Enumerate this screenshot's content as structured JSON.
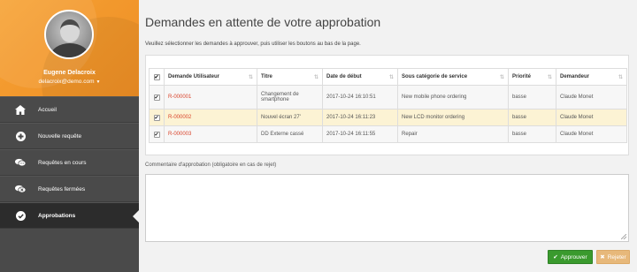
{
  "user": {
    "name": "Eugene Delacroix",
    "email": "delacroix@demo.com"
  },
  "nav": {
    "items": [
      {
        "label": "Accueil",
        "icon": "home-icon"
      },
      {
        "label": "Nouvelle requête",
        "icon": "plus-circle-icon"
      },
      {
        "label": "Requêtes en cours",
        "icon": "chat-bubbles-icon"
      },
      {
        "label": "Requêtes fermées",
        "icon": "chat-bubbles-closed-icon"
      },
      {
        "label": "Approbations",
        "icon": "check-circle-icon",
        "active": true
      }
    ]
  },
  "main": {
    "title": "Demandes en attente de votre approbation",
    "instructions": "Veuillez sélectionner les demandes à approuver, puis utiliser les boutons au bas de la page."
  },
  "table": {
    "columns": [
      "Demande Utilisateur",
      "Titre",
      "Date de début",
      "Sous catégorie de service",
      "Priorité",
      "Demandeur"
    ],
    "rows": [
      {
        "id": "R-000001",
        "title": "Changement de smartphone",
        "date": "2017-10-24 16:10:51",
        "subcategory": "New mobile phone ordering",
        "priority": "basse",
        "requester": "Claude Monet",
        "checked": true
      },
      {
        "id": "R-000002",
        "title": "Nouvel écran 27'",
        "date": "2017-10-24 16:11:23",
        "subcategory": "New LCD monitor ordering",
        "priority": "basse",
        "requester": "Claude Monet",
        "checked": true
      },
      {
        "id": "R-000003",
        "title": "DD Externe cassé",
        "date": "2017-10-24 16:11:55",
        "subcategory": "Repair",
        "priority": "basse",
        "requester": "Claude Monet",
        "checked": true
      }
    ]
  },
  "comment": {
    "label": "Commentaire d'approbation (obligatoire en cas de rejet)",
    "value": ""
  },
  "buttons": {
    "approve": "Approuver",
    "reject": "Rejeter"
  },
  "colors": {
    "accent": "#f39a2e",
    "approve": "#3a9a2e",
    "reject": "#e7b87a",
    "link": "#d9442b",
    "sidebar": "#4a4a4a"
  }
}
